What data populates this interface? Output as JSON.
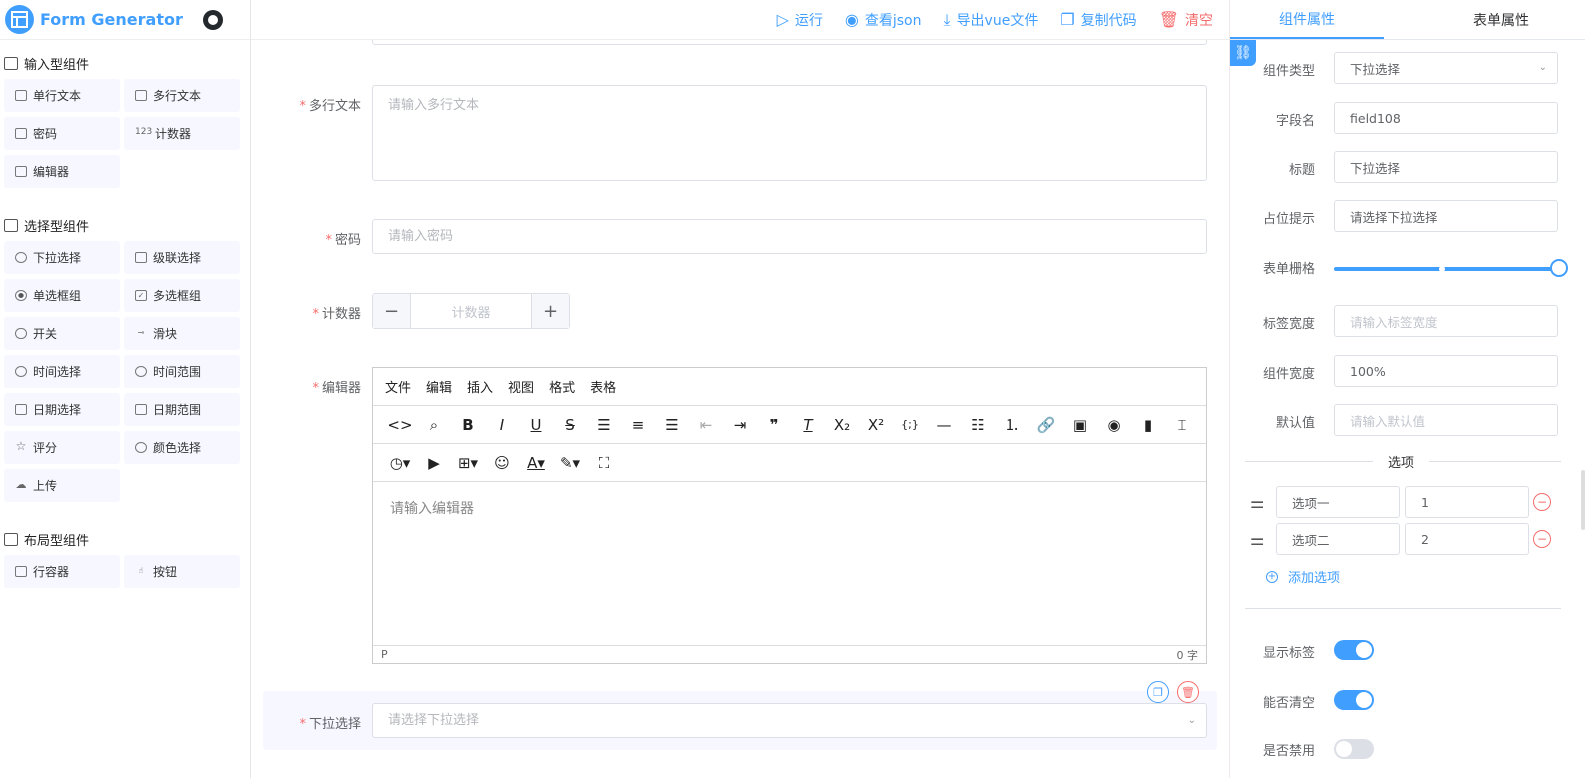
{
  "app": {
    "title": "Form Generator"
  },
  "toolbar": {
    "run": "运行",
    "view_json": "查看json",
    "export_vue": "导出vue文件",
    "copy_code": "复制代码",
    "clear": "清空"
  },
  "palette": {
    "groups": [
      {
        "title": "输入型组件",
        "items": [
          "单行文本",
          "多行文本",
          "密码",
          "计数器",
          "编辑器"
        ]
      },
      {
        "title": "选择型组件",
        "items": [
          "下拉选择",
          "级联选择",
          "单选框组",
          "多选框组",
          "开关",
          "滑块",
          "时间选择",
          "时间范围",
          "日期选择",
          "日期范围",
          "评分",
          "颜色选择",
          "上传"
        ]
      },
      {
        "title": "布局型组件",
        "items": [
          "行容器",
          "按钮"
        ]
      }
    ]
  },
  "canvas": {
    "textarea": {
      "label": "多行文本",
      "placeholder": "请输入多行文本"
    },
    "password": {
      "label": "密码",
      "placeholder": "请输入密码"
    },
    "counter": {
      "label": "计数器",
      "placeholder": "计数器",
      "minus": "−",
      "plus": "+"
    },
    "editor": {
      "label": "编辑器",
      "menus": [
        "文件",
        "编辑",
        "插入",
        "视图",
        "格式",
        "表格"
      ],
      "placeholder": "请输入编辑器",
      "status_left": "P",
      "status_right": "0 字"
    },
    "select": {
      "label": "下拉选择",
      "placeholder": "请选择下拉选择"
    }
  },
  "props": {
    "tabs": [
      "组件属性",
      "表单属性"
    ],
    "component_type": {
      "label": "组件类型",
      "value": "下拉选择"
    },
    "field_name": {
      "label": "字段名",
      "value": "field108"
    },
    "title": {
      "label": "标题",
      "value": "下拉选择"
    },
    "placeholder": {
      "label": "占位提示",
      "value": "请选择下拉选择"
    },
    "span": {
      "label": "表单栅格",
      "value": 24,
      "max": 24
    },
    "label_width": {
      "label": "标签宽度",
      "placeholder": "请输入标签宽度"
    },
    "width": {
      "label": "组件宽度",
      "value": "100%"
    },
    "default_value": {
      "label": "默认值",
      "placeholder": "请输入默认值"
    },
    "options_title": "选项",
    "options": [
      {
        "label": "选项一",
        "value": "1"
      },
      {
        "label": "选项二",
        "value": "2"
      }
    ],
    "add_option": "添加选项",
    "show_label": {
      "label": "显示标签",
      "value": true
    },
    "clearable": {
      "label": "能否清空",
      "value": true
    },
    "disabled": {
      "label": "是否禁用",
      "value": false
    }
  },
  "colors": {
    "accent": "#409eff",
    "danger": "#f56c6c",
    "palette_bg": "#f6f7ff"
  }
}
